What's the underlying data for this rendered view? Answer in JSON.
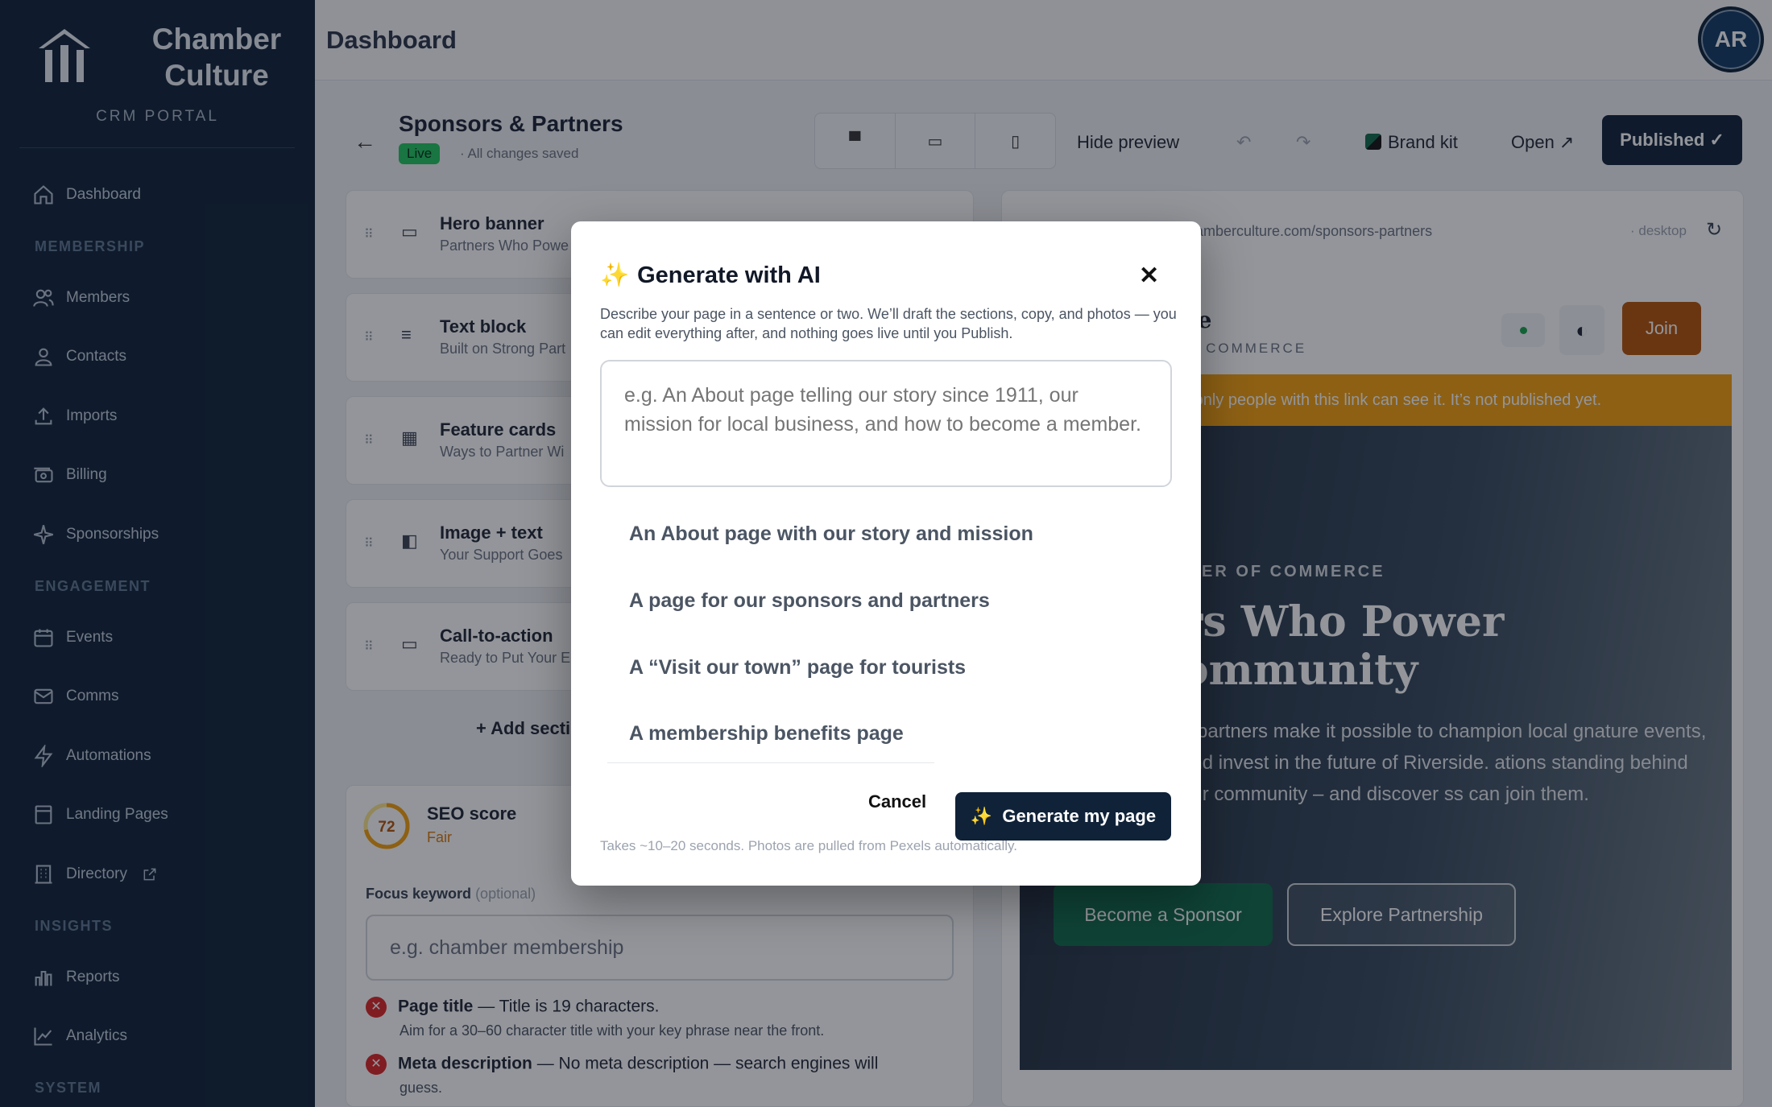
{
  "brand": {
    "title": "Chamber Culture",
    "subtitle": "CRM PORTAL"
  },
  "sidebar": {
    "items": [
      {
        "label": "Dashboard",
        "icon": "home-icon"
      },
      {
        "label": "Members",
        "icon": "users-icon"
      },
      {
        "label": "Contacts",
        "icon": "user-icon"
      },
      {
        "label": "Imports",
        "icon": "upload-icon"
      },
      {
        "label": "Billing",
        "icon": "billing-icon"
      },
      {
        "label": "Sponsorships",
        "icon": "sparkle-icon"
      },
      {
        "label": "Events",
        "icon": "calendar-icon"
      },
      {
        "label": "Comms",
        "icon": "mail-icon"
      },
      {
        "label": "Automations",
        "icon": "bolt-icon"
      },
      {
        "label": "Landing Pages",
        "icon": "layout-icon"
      },
      {
        "label": "Directory",
        "icon": "building-icon"
      },
      {
        "label": "Reports",
        "icon": "bar-chart-icon"
      },
      {
        "label": "Analytics",
        "icon": "line-chart-icon"
      }
    ],
    "sections": {
      "membership": "MEMBERSHIP",
      "engagement": "ENGAGEMENT",
      "insights": "INSIGHTS",
      "system": "SYSTEM"
    }
  },
  "topbar": {
    "title": "Dashboard",
    "avatar": "AR"
  },
  "editor": {
    "page_name": "Sponsors & Partners",
    "status": "Live",
    "saved": "· All changes saved",
    "hide_preview": "Hide preview",
    "brand_kit": "Brand kit",
    "open": "Open ↗",
    "published": "Published ✓"
  },
  "sections": [
    {
      "title": "Hero banner",
      "subtitle": "Partners Who Powe"
    },
    {
      "title": "Text block",
      "subtitle": "Built on Strong Part"
    },
    {
      "title": "Feature cards",
      "subtitle": "Ways to Partner Wi"
    },
    {
      "title": "Image + text",
      "subtitle": "Your Support Goes"
    },
    {
      "title": "Call-to-action",
      "subtitle": "Ready to Put Your E"
    }
  ],
  "add_section": "+ Add section",
  "seo": {
    "score": "72",
    "title": "SEO score",
    "rating": "Fair",
    "focus_label": "Focus keyword",
    "focus_optional": "(optional)",
    "focus_placeholder": "e.g. chamber membership",
    "checks": [
      {
        "title": "Page title",
        "text": " — Title is 19 characters.",
        "sub": "Aim for a 30–60 character title with your key phrase near the front."
      },
      {
        "title": "Meta description",
        "text": " — No meta description — search engines will",
        "sub": "guess."
      }
    ]
  },
  "preview": {
    "url": "amberculture.com/sponsors-partners",
    "mode": "· desktop",
    "site_name": "le",
    "site_sub": "F COMMERCE",
    "join": "Join",
    "notice": "– only people with this link can see it. It’s not published yet.",
    "kicker": "IBER OF COMMERCE",
    "hero_title_1": "rs Who Power",
    "hero_title_2": "ommunity",
    "hero_text": "d partners make it possible to champion local gnature events, and invest in the future of Riverside. ations standing behind our community – and discover ss can join them.",
    "btn_sponsor": "Become a Sponsor",
    "btn_explore": "Explore Partnership"
  },
  "modal": {
    "title": "Generate with AI",
    "description": "Describe your page in a sentence or two. We’ll draft the sections, copy, and photos — you can edit everything after, and nothing goes live until you Publish.",
    "placeholder": "e.g. An About page telling our story since 1911, our mission for local business, and how to become a member.",
    "suggestions": [
      "An About page with our story and mission",
      "A page for our sponsors and partners",
      "A “Visit our town” page for tourists",
      "A membership benefits page"
    ],
    "cancel": "Cancel",
    "generate": "Generate my page",
    "footnote": "Takes ~10–20 seconds. Photos are pulled from Pexels automatically."
  }
}
